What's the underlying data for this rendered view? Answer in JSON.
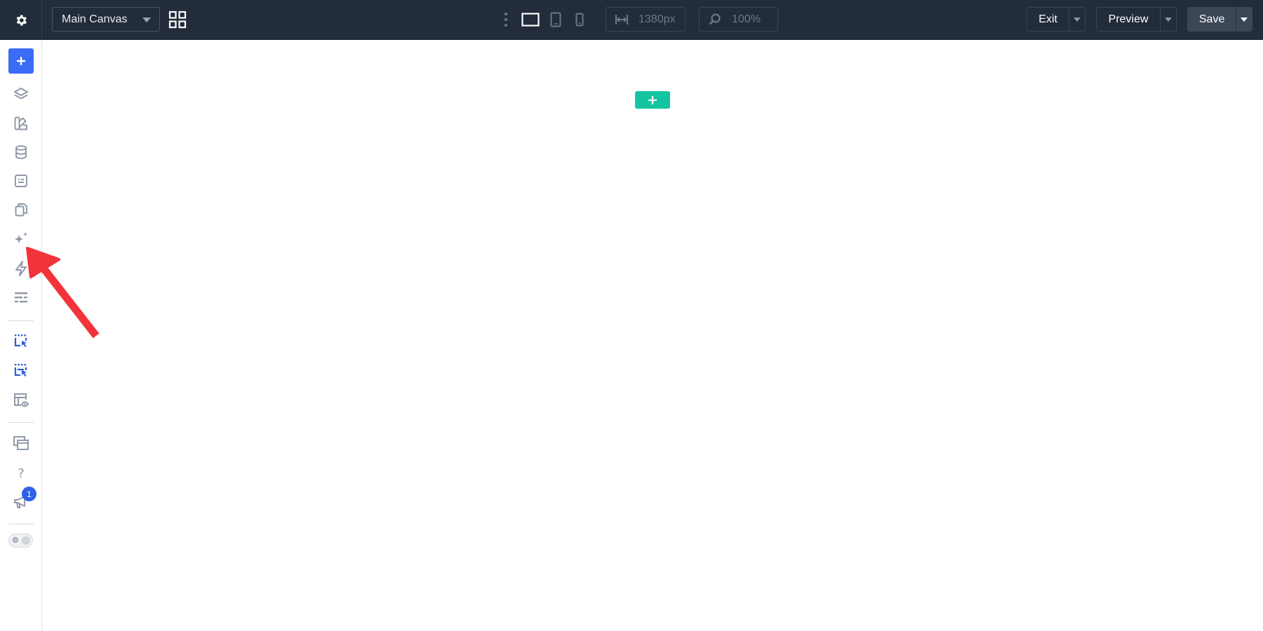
{
  "header": {
    "canvas_selector": {
      "value": "Main Canvas"
    },
    "width_field": {
      "value": "1380px"
    },
    "zoom_field": {
      "value": "100%"
    },
    "exit_label": "Exit",
    "preview_label": "Preview",
    "save_label": "Save"
  },
  "sidebar": {
    "items": [
      {
        "name": "add",
        "icon": "plus-icon"
      },
      {
        "name": "layers",
        "icon": "layers-icon"
      },
      {
        "name": "styles",
        "icon": "palette-icon"
      },
      {
        "name": "data",
        "icon": "database-icon"
      },
      {
        "name": "forms",
        "icon": "form-icon"
      },
      {
        "name": "pages",
        "icon": "copy-icon"
      },
      {
        "name": "ai",
        "icon": "sparkles-icon"
      },
      {
        "name": "interactions",
        "icon": "lightning-icon"
      },
      {
        "name": "settings-list",
        "icon": "list-icon"
      },
      {
        "name": "select",
        "icon": "select-cursor-icon"
      },
      {
        "name": "multi-select",
        "icon": "multi-select-cursor-icon"
      },
      {
        "name": "preview-layout",
        "icon": "layout-eye-icon"
      },
      {
        "name": "templates",
        "icon": "windows-icon"
      },
      {
        "name": "help",
        "icon": "question-icon",
        "label": "?"
      },
      {
        "name": "announcements",
        "icon": "megaphone-icon",
        "badge": "1"
      },
      {
        "name": "theme-toggle",
        "icon": "toggle-icon"
      }
    ]
  },
  "colors": {
    "topbar": "#222c3a",
    "accent_blue": "#3b6cf6",
    "section_add_green": "#13c4a1",
    "annotation_arrow": "#f2333a"
  }
}
